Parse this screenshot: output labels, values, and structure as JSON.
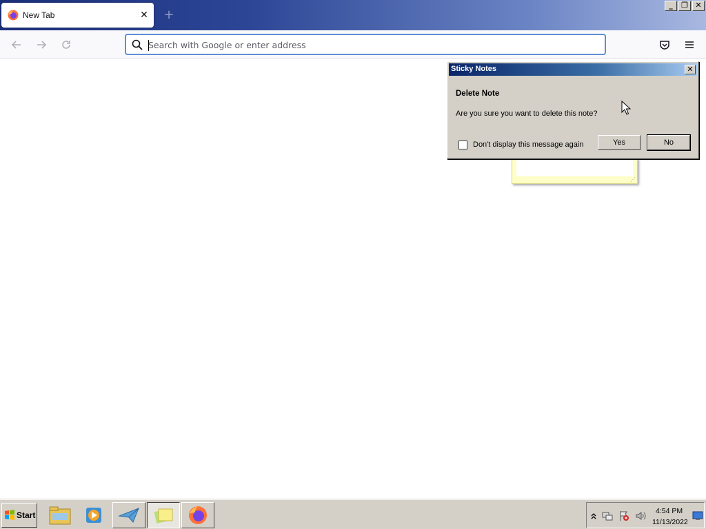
{
  "browser": {
    "tab": {
      "title": "New Tab",
      "close_glyph": "✕"
    },
    "new_tab_glyph": "+",
    "window_controls": {
      "minimize": "_",
      "restore": "❐",
      "close": "✕"
    },
    "urlbar": {
      "placeholder": "Search with Google or enter address",
      "value": ""
    }
  },
  "dialog": {
    "title": "Sticky Notes",
    "close_glyph": "✕",
    "heading": "Delete Note",
    "message": "Are you sure you want to delete this note?",
    "checkbox_label": "Don't display this message again",
    "checkbox_checked": false,
    "yes_label": "Yes",
    "no_label": "No"
  },
  "taskbar": {
    "start_label": "Start",
    "apps": [
      "file-explorer-icon",
      "media-player-icon",
      "mail-icon",
      "sticky-notes-icon",
      "firefox-icon"
    ],
    "tray": {
      "time": "4:54 PM",
      "date": "11/13/2022"
    }
  },
  "colors": {
    "titlebar_dark": "#1b2f7a",
    "urlbar_focus": "#5b8fd6",
    "dialog_face": "#d4d0c8",
    "sticky_yellow": "#fefec8"
  }
}
